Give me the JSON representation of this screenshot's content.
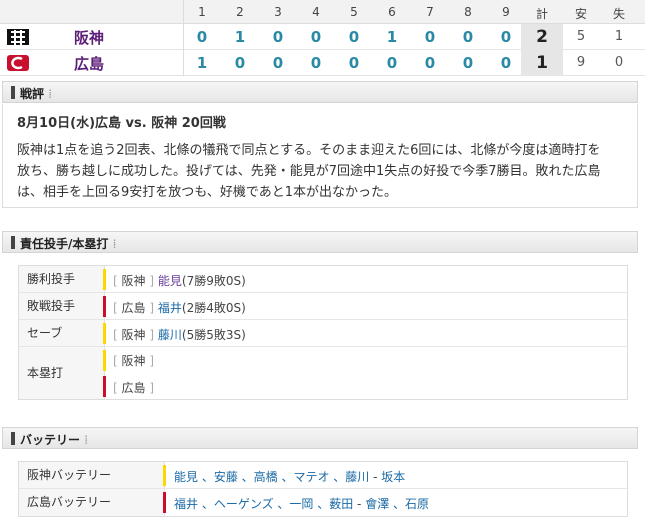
{
  "scoreboard": {
    "innings_header": [
      "1",
      "2",
      "3",
      "4",
      "5",
      "6",
      "7",
      "8",
      "9"
    ],
    "total_header": "計",
    "hits_header": "安",
    "errors_header": "失",
    "teams": [
      {
        "name": "阪神",
        "innings": [
          "0",
          "1",
          "0",
          "0",
          "0",
          "1",
          "0",
          "0",
          "0"
        ],
        "total": "2",
        "hits": "5",
        "errors": "1",
        "color": "#5c1e79"
      },
      {
        "name": "広島",
        "innings": [
          "1",
          "0",
          "0",
          "0",
          "0",
          "0",
          "0",
          "0",
          "0"
        ],
        "total": "1",
        "hits": "9",
        "errors": "0",
        "color": "#c8102e"
      }
    ]
  },
  "review": {
    "section_label": "戦評",
    "title": "8月10日(水)広島 vs. 阪神 20回戦",
    "lines": [
      "阪神は1点を追う2回表、北條の犠飛で同点とする。そのまま迎えた6回には、北條が今度は適時打を",
      "放ち、勝ち越しに成功した。投げては、先発・能見が7回途中1失点の好投で今季7勝目。敗れた広島",
      "は、相手を上回る9安打を放つも、好機であと1本が出なかった。"
    ]
  },
  "pitchers": {
    "section_label": "責任投手/本塁打",
    "win_label": "勝利投手",
    "win_team": "阪神",
    "win_name": "能見",
    "win_record": "(7勝9敗0S)",
    "loss_label": "敗戦投手",
    "loss_team": "広島",
    "loss_name": "福井",
    "loss_record": "(2勝4敗0S)",
    "save_label": "セーブ",
    "save_team": "阪神",
    "save_name": "藤川",
    "save_record": "(5勝5敗3S)",
    "hr_label": "本塁打",
    "hr_team1": "阪神",
    "hr_team2": "広島"
  },
  "battery": {
    "section_label": "バッテリー",
    "hanshin_label": "阪神バッテリー",
    "hanshin_pitchers": "能見 、安藤 、高橋 、マテオ 、藤川",
    "hanshin_dash": "-",
    "hanshin_catcher": "坂本",
    "hiroshima_label": "広島バッテリー",
    "hiroshima_pitchers": "福井 、ヘーゲンズ 、一岡 、薮田",
    "hiroshima_dash": "-",
    "hiroshima_catchers": "會澤 、石原"
  }
}
